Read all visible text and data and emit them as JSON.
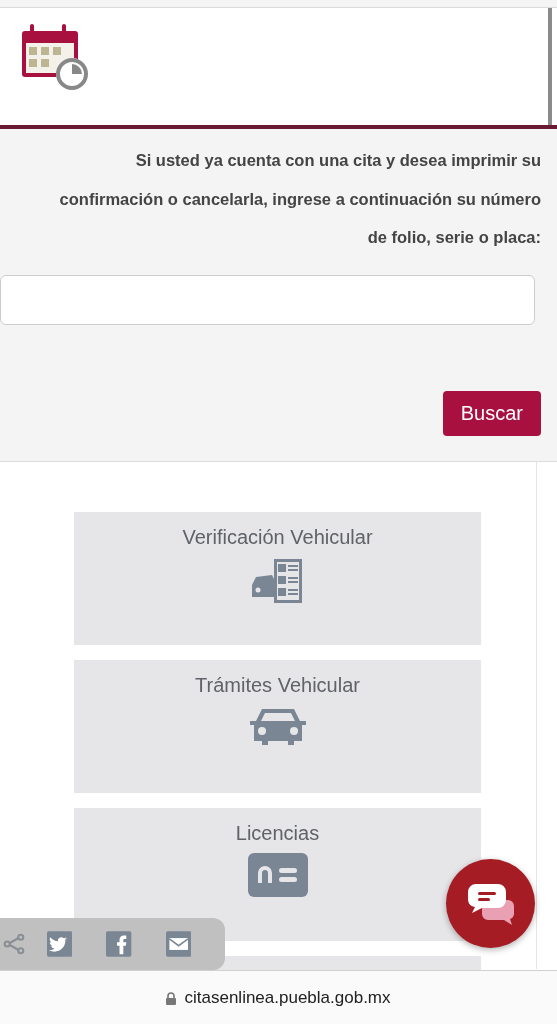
{
  "lookup": {
    "instructions": "Si usted ya cuenta con una cita y desea imprimir su confirmación o cancelarla, ingrese a continuación su número de folio, serie o placa:",
    "search_button": "Buscar"
  },
  "services": [
    {
      "label": "Verificación Vehicular",
      "kind": "inspection"
    },
    {
      "label": "Trámites Vehicular",
      "kind": "car"
    },
    {
      "label": "Licencias",
      "kind": "license"
    }
  ],
  "share": [
    {
      "kind": "share"
    },
    {
      "kind": "twitter"
    },
    {
      "kind": "facebook"
    },
    {
      "kind": "email"
    }
  ],
  "address_bar": {
    "url": "citasenlinea.puebla.gob.mx"
  }
}
